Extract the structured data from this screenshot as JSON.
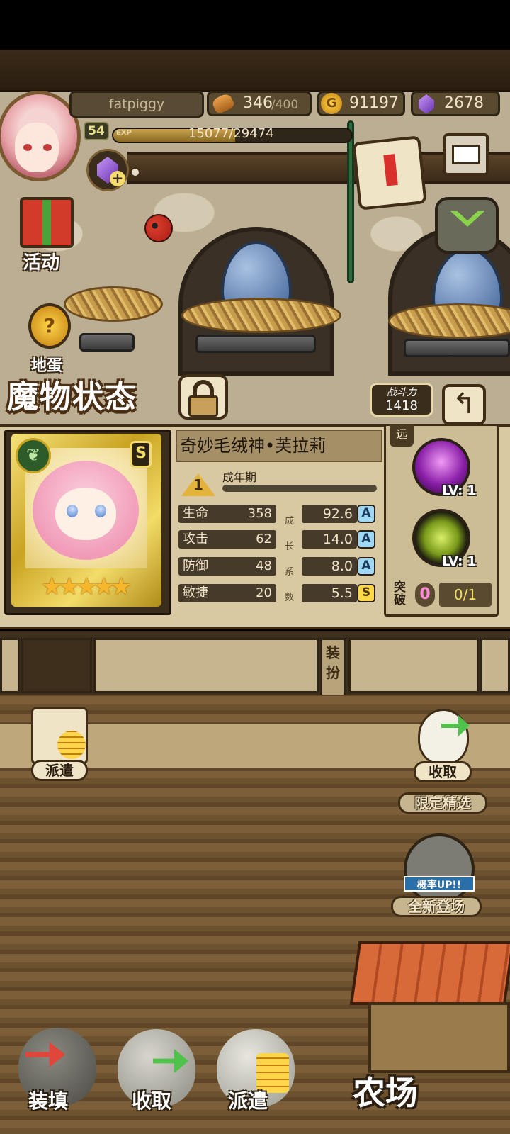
{
  "player": {
    "name": "fatpiggy",
    "level": "54",
    "exp_tag": "EXP",
    "exp_text": "15077/29474",
    "exp_progress": 0.512
  },
  "resources": {
    "bread_current": "346",
    "bread_max": "/400",
    "gold": "91197",
    "gems": "2678"
  },
  "side_buttons": {
    "activity": "活动",
    "egg_partial": "地蛋"
  },
  "status": {
    "title": "魔物状态",
    "power_label": "战斗力",
    "power_value": "1418"
  },
  "monster": {
    "name": "奇妙毛绒神•芙拉莉",
    "rank": "S",
    "element_icon": "leaf-icon",
    "stars": "★★★★★",
    "stage_number": "1",
    "stage_label": "成年期",
    "stats": [
      {
        "name": "生命",
        "value": "358",
        "growth": "92.6",
        "grade": "A"
      },
      {
        "name": "攻击",
        "value": "62",
        "growth": "14.0",
        "grade": "A"
      },
      {
        "name": "防御",
        "value": "48",
        "growth": "8.0",
        "grade": "A"
      },
      {
        "name": "敏捷",
        "value": "20",
        "growth": "5.5",
        "grade": "S"
      }
    ],
    "growth_chars": [
      "成",
      "长",
      "系",
      "数"
    ]
  },
  "skills": {
    "range_tag": "远",
    "skill1_lv": "LV: 1",
    "skill2_lv": "LV: 1",
    "break_label": "突破",
    "break_count": "0",
    "break_progress": "0/1"
  },
  "equip": {
    "dress_tab": "装扮"
  },
  "farm_buttons": {
    "dispatch": "派遣",
    "collect": "收取",
    "limited": "限定精选",
    "banner_tag": "概率UP!!",
    "new_arrival": "全新登场"
  },
  "bottom_nav": {
    "load": "装填",
    "collect": "收取",
    "dispatch": "派遣",
    "farm": "农场"
  },
  "colors": {
    "gold_accent": "#f3dc69",
    "grade_a": "#9fd8f4",
    "grade_s": "#ffd84a",
    "break_pink": "#ff8bd7"
  }
}
